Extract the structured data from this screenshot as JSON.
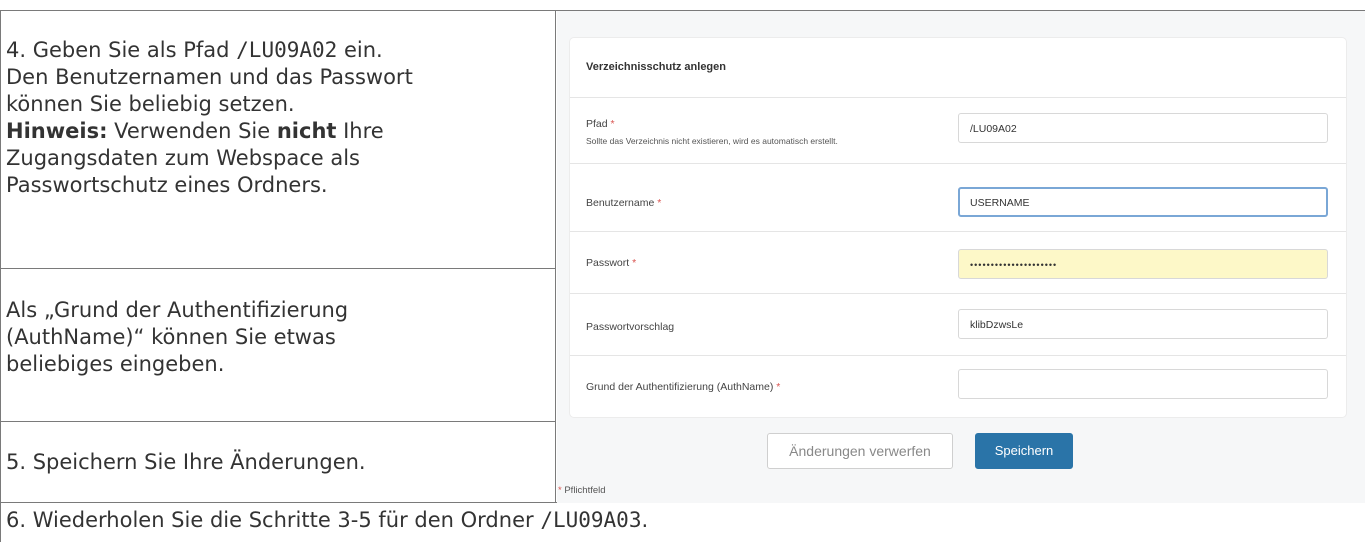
{
  "steps": {
    "step4_text": "4. Geben Sie als Pfad ",
    "step4_path": "/LU09A02",
    "step4_text_end": " ein.",
    "step4_line2": "Den Benutzernamen und das Passwort",
    "step4_line3": "können Sie beliebig setzen.",
    "hint_label": "Hinweis:",
    "hint_text1": " Verwenden Sie ",
    "hint_nicht": "nicht",
    "hint_text2": " Ihre",
    "hint_line2": "Zugangsdaten zum Webspace als",
    "hint_line3": "Passwortschutz eines Ordners.",
    "authname_line1": "Als „Grund der Authentifizierung",
    "authname_line2": "(AuthName)“ können Sie etwas",
    "authname_line3": "beliebiges eingeben.",
    "step5_text": "5. Speichern Sie Ihre Änderungen.",
    "step6_text": "6. Wiederholen Sie die Schritte 3-5 für den Ordner ",
    "step6_path": "/LU09A03",
    "step6_end": "."
  },
  "form": {
    "title": "Verzeichnisschutz anlegen",
    "path_label": "Pfad",
    "path_hint": "Sollte das Verzeichnis nicht existieren, wird es automatisch erstellt.",
    "path_value": "/LU09A02",
    "username_label": "Benutzername",
    "username_value": "USERNAME",
    "password_label": "Passwort",
    "password_value": "•••••••••••••••••••••",
    "suggestion_label": "Passwortvorschlag",
    "suggestion_value": "klibDzwsLe",
    "authname_label": "Grund der Authentifizierung (AuthName)",
    "authname_value": "",
    "required_star": "*",
    "discard_label": "Änderungen verwerfen",
    "save_label": "Speichern",
    "required_note": "Pflichtfeld"
  },
  "colors": {
    "accent": "#2a74a8",
    "required": "#d9534f",
    "password_bg": "#fdf8c8"
  }
}
